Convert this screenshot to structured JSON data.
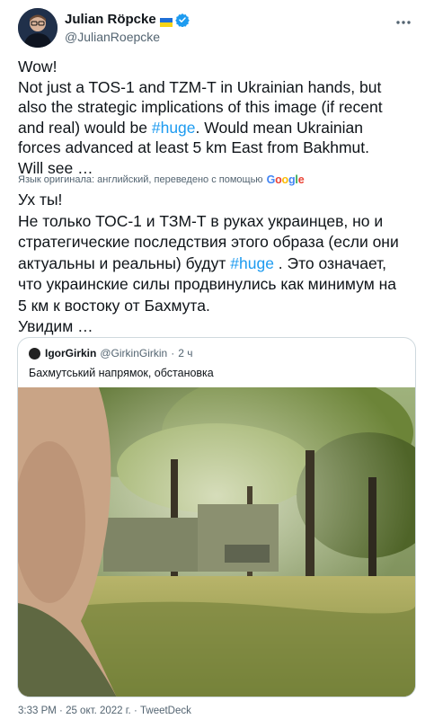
{
  "author": {
    "display_name": "Julian Röpcke",
    "handle": "@JulianRoepcke"
  },
  "tweet": {
    "line1": "Wow!",
    "line2": "Not just a TOS-1 and TZM-T in Ukrainian hands, but",
    "line3": "also the strategic implications of this image (if recent",
    "line4_pre": "and real) would be ",
    "line4_tag": "#huge",
    "line4_post": ". Would mean Ukrainian",
    "line5": "forces advanced at least 5 km East from Bakhmut.",
    "line6": "Will see …"
  },
  "translation_note": {
    "text": "Язык оригинала: английский, переведено с помощью",
    "provider": "Google"
  },
  "translated": {
    "line1": "Ух ты!",
    "line2": "Не только ТОС-1 и ТЗМ-Т в руках украинцев, но и",
    "line3": "стратегические последствия этого образа (если они",
    "line4_pre": "актуальны и реальны) будут ",
    "line4_tag": "#huge",
    "line4_post": " . Это означает,",
    "line5": "что украинские силы продвинулись как минимум на",
    "line6": "5 км к востоку от Бахмута.",
    "line7": "Увидим …"
  },
  "quoted": {
    "name": "IgorGirkin",
    "handle": "@GirkinGirkin",
    "separator": "·",
    "time": "2 ч",
    "text": "Бахмутський напрямок, обстановка"
  },
  "footer": {
    "time": "3:33 PM",
    "separator": " · ",
    "date": "25 окт. 2022 г.",
    "source": "TweetDeck"
  },
  "colors": {
    "link": "#1d9bf0",
    "secondary_text": "#536471",
    "border": "#cfd9de"
  },
  "icons": [
    "flag-icon",
    "verified-icon",
    "more-icon",
    "google-logo"
  ]
}
